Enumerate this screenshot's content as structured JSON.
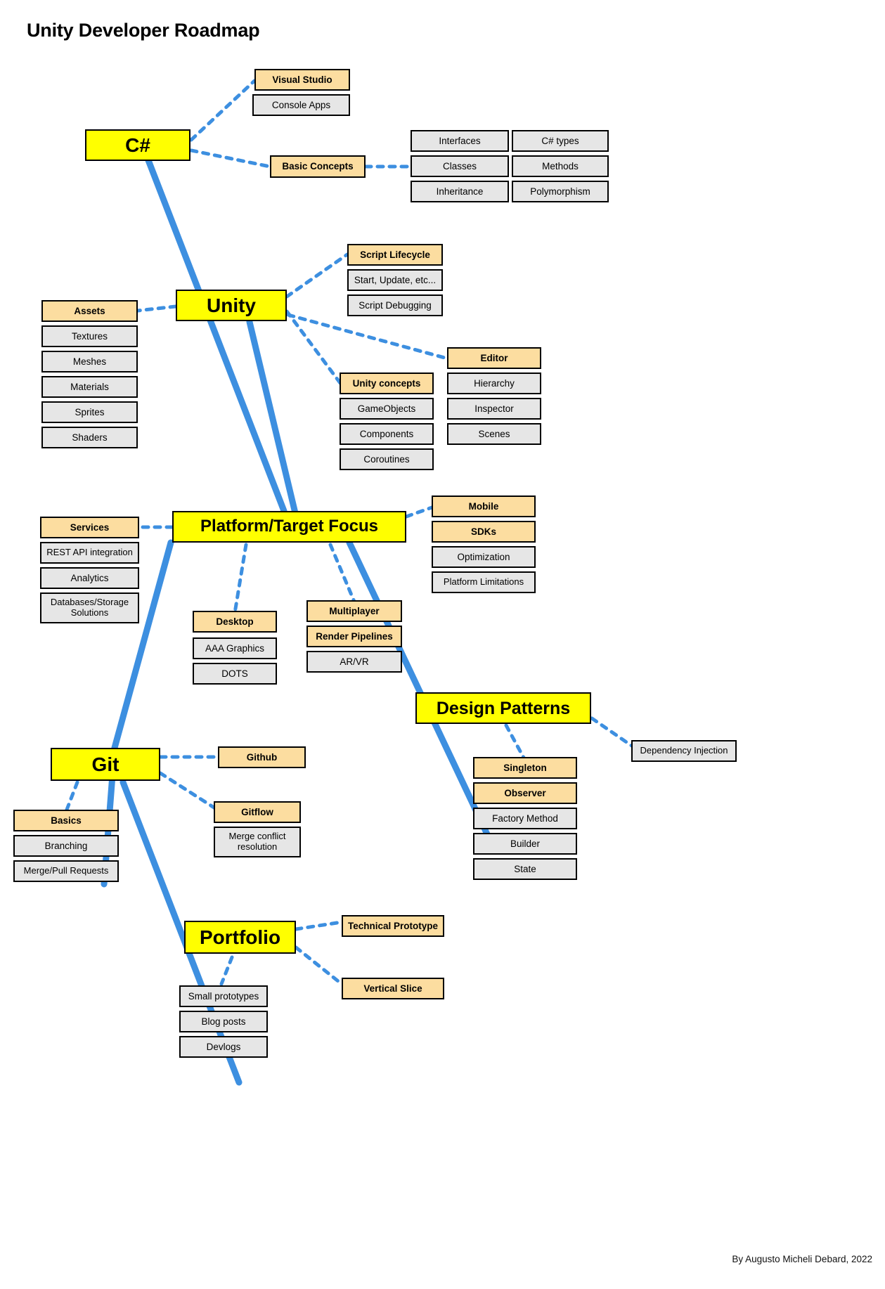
{
  "page": {
    "title": "Unity Developer Roadmap",
    "credit": "By Augusto Micheli Debard, 2022",
    "colors": {
      "main_node": "#ffff00",
      "sub_node": "#fcdda0",
      "leaf_node": "#e6e6e6",
      "spine": "#3d8fe0",
      "connector": "#3d8fe0",
      "border": "#000000",
      "background": "#ffffff"
    }
  },
  "nodes": {
    "csharp": "C#",
    "visual_studio": "Visual Studio",
    "console_apps": "Console Apps",
    "basic_concepts": "Basic Concepts",
    "interfaces": "Interfaces",
    "classes": "Classes",
    "inheritance": "Inheritance",
    "csharp_types": "C# types",
    "methods": "Methods",
    "polymorphism": "Polymorphism",
    "unity": "Unity",
    "script_lifecycle": "Script Lifecycle",
    "start_update": "Start, Update, etc...",
    "script_debugging": "Script Debugging",
    "assets": "Assets",
    "textures": "Textures",
    "meshes": "Meshes",
    "materials": "Materials",
    "sprites": "Sprites",
    "shaders": "Shaders",
    "unity_concepts": "Unity concepts",
    "gameobjects": "GameObjects",
    "components": "Components",
    "coroutines": "Coroutines",
    "editor": "Editor",
    "hierarchy": "Hierarchy",
    "inspector": "Inspector",
    "scenes": "Scenes",
    "platform_focus": "Platform/Target Focus",
    "services": "Services",
    "rest_api": "REST API integration",
    "analytics": "Analytics",
    "databases": "Databases/Storage Solutions",
    "mobile": "Mobile",
    "sdks": "SDKs",
    "optimization": "Optimization",
    "platform_limitations": "Platform Limitations",
    "desktop": "Desktop",
    "aaa_graphics": "AAA Graphics",
    "dots": "DOTS",
    "multiplayer": "Multiplayer",
    "render_pipelines": "Render Pipelines",
    "arvr": "AR/VR",
    "design_patterns": "Design Patterns",
    "dependency_injection": "Dependency Injection",
    "singleton": "Singleton",
    "observer": "Observer",
    "factory_method": "Factory Method",
    "builder": "Builder",
    "state": "State",
    "git": "Git",
    "github": "Github",
    "gitflow": "Gitflow",
    "merge_conflict": "Merge conflict resolution",
    "basics": "Basics",
    "branching": "Branching",
    "merge_pull_requests": "Merge/Pull Requests",
    "portfolio": "Portfolio",
    "technical_prototype": "Technical Prototype",
    "vertical_slice": "Vertical Slice",
    "small_prototypes": "Small prototypes",
    "blog_posts": "Blog posts",
    "devlogs": "Devlogs"
  }
}
